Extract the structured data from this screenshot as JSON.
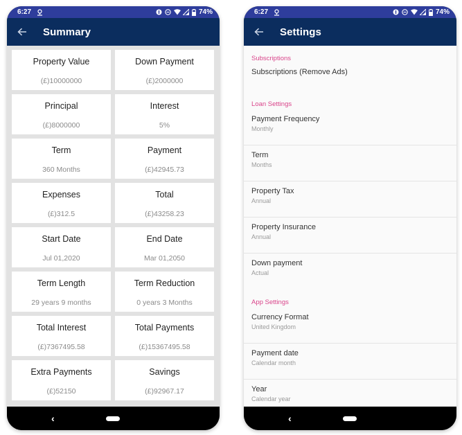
{
  "status_bar": {
    "time": "6:27",
    "battery": "74%",
    "icons": [
      "location-pin-icon",
      "data-saver-icon",
      "do-not-disturb-icon",
      "wifi-icon",
      "signal-icon",
      "battery-icon"
    ]
  },
  "summary_screen": {
    "title": "Summary",
    "back_icon": "arrow-left-icon",
    "cards": [
      {
        "label": "Property Value",
        "value": "(£)10000000"
      },
      {
        "label": "Down Payment",
        "value": "(£)2000000"
      },
      {
        "label": "Principal",
        "value": "(£)8000000"
      },
      {
        "label": "Interest",
        "value": "5%"
      },
      {
        "label": "Term",
        "value": "360 Months"
      },
      {
        "label": "Payment",
        "value": "(£)42945.73"
      },
      {
        "label": "Expenses",
        "value": "(£)312.5"
      },
      {
        "label": "Total",
        "value": "(£)43258.23"
      },
      {
        "label": "Start Date",
        "value": "Jul 01,2020"
      },
      {
        "label": "End Date",
        "value": "Mar 01,2050"
      },
      {
        "label": "Term Length",
        "value": "29 years 9 months"
      },
      {
        "label": "Term Reduction",
        "value": "0 years 3 Months"
      },
      {
        "label": "Total Interest",
        "value": "(£)7367495.58"
      },
      {
        "label": "Total Payments",
        "value": "(£)15367495.58"
      },
      {
        "label": "Extra Payments",
        "value": "(£)52150"
      },
      {
        "label": "Savings",
        "value": "(£)92967.17"
      }
    ]
  },
  "settings_screen": {
    "title": "Settings",
    "back_icon": "arrow-left-icon",
    "sections": [
      {
        "header": "Subscriptions",
        "items": [
          {
            "title": "Subscriptions (Remove Ads)",
            "summary": ""
          }
        ]
      },
      {
        "header": "Loan Settings",
        "items": [
          {
            "title": "Payment Frequency",
            "summary": "Monthly"
          },
          {
            "title": "Term",
            "summary": "Months"
          },
          {
            "title": "Property Tax",
            "summary": "Annual"
          },
          {
            "title": "Property Insurance",
            "summary": "Annual"
          },
          {
            "title": "Down payment",
            "summary": "Actual"
          }
        ]
      },
      {
        "header": "App Settings",
        "items": [
          {
            "title": "Currency Format",
            "summary": "United Kingdom"
          },
          {
            "title": "Payment date",
            "summary": "Calendar month"
          },
          {
            "title": "Year",
            "summary": "Calendar year"
          }
        ]
      }
    ]
  },
  "nav_bar": {
    "back_icon": "nav-back-chevron-icon",
    "home_icon": "nav-home-pill-icon"
  },
  "colors": {
    "status_bar": "#2e3d9c",
    "app_bar": "#0b2d5e",
    "section_header_accent": "#d9448a",
    "summary_background": "#e2e2e2",
    "card_background": "#ffffff"
  }
}
